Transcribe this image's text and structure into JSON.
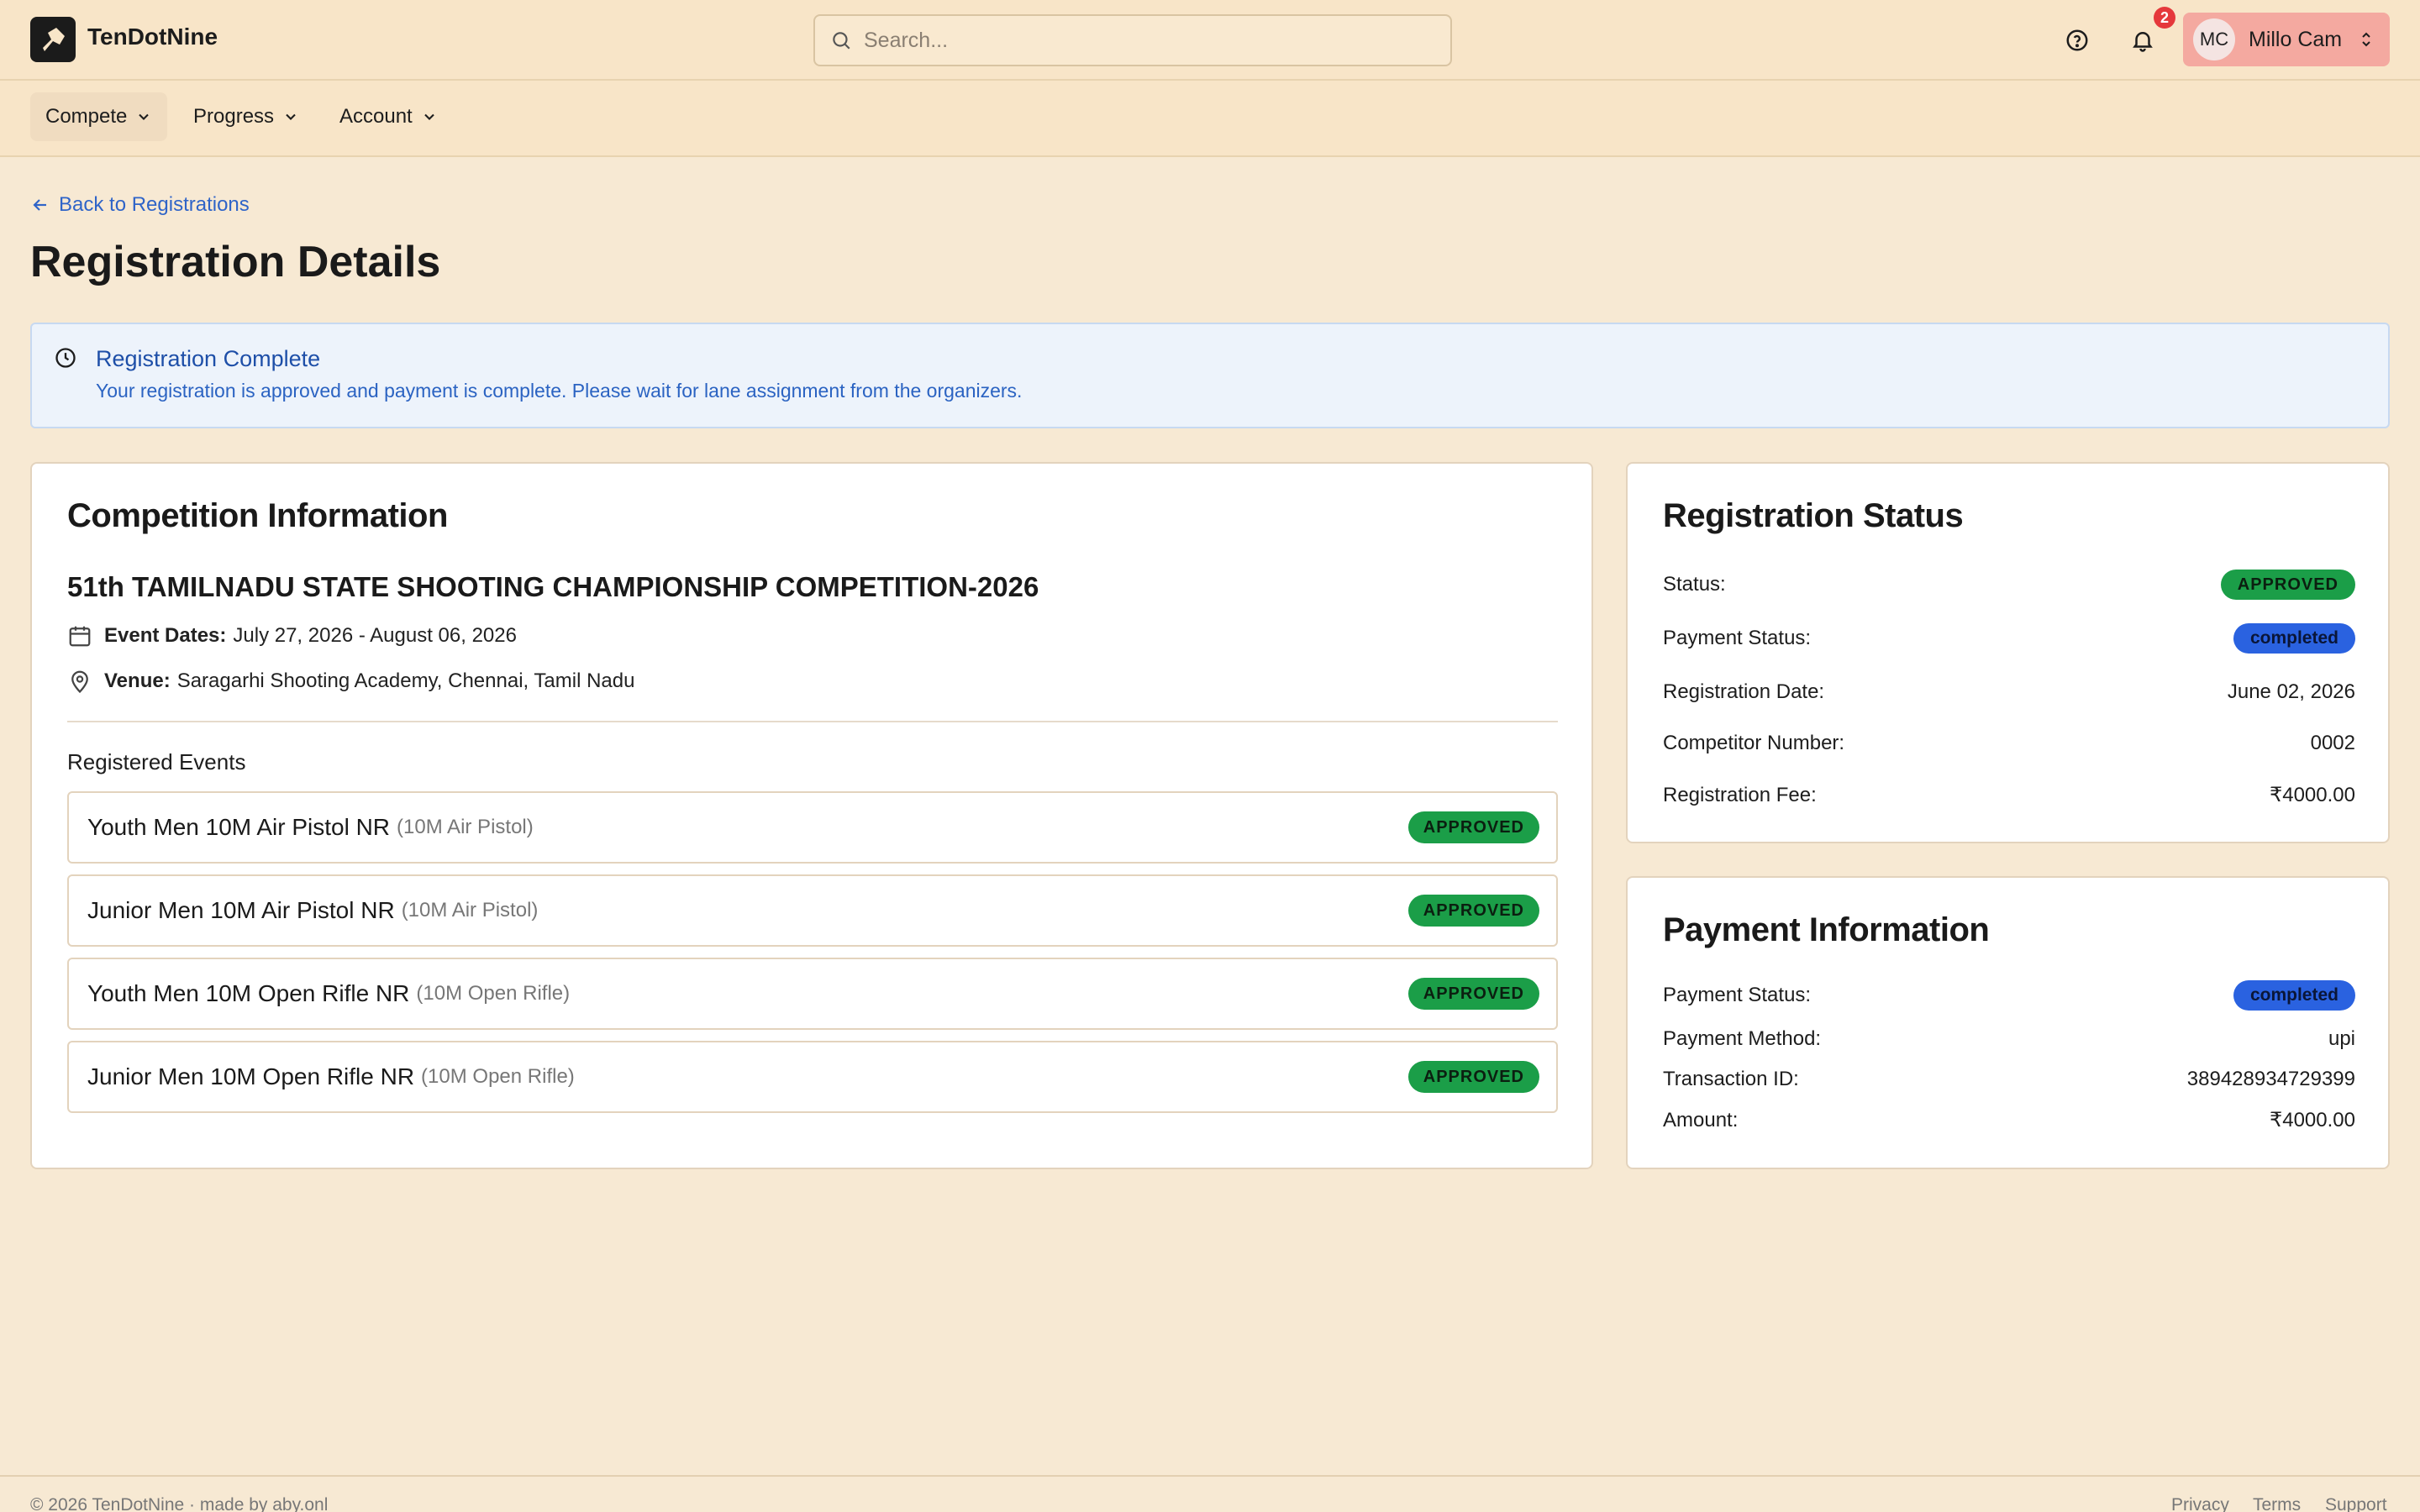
{
  "header": {
    "brand": "TenDotNine",
    "search_placeholder": "Search...",
    "notification_count": "2",
    "user_initials": "MC",
    "user_name": "Millo Cam"
  },
  "nav": {
    "items": [
      {
        "label": "Compete"
      },
      {
        "label": "Progress"
      },
      {
        "label": "Account"
      }
    ]
  },
  "page": {
    "back_link": "Back to Registrations",
    "title": "Registration Details"
  },
  "alert": {
    "title": "Registration Complete",
    "message": "Your registration is approved and payment is complete. Please wait for lane assignment from the organizers."
  },
  "competition": {
    "heading": "Competition Information",
    "name": "51th TAMILNADU STATE SHOOTING CHAMPIONSHIP COMPETITION-2026",
    "dates_label": "Event Dates:",
    "dates_value": "July 27, 2026 - August 06, 2026",
    "venue_label": "Venue:",
    "venue_value": "Saragarhi Shooting Academy, Chennai, Tamil Nadu",
    "registered_label": "Registered Events",
    "events": [
      {
        "name": "Youth Men 10M Air Pistol NR",
        "category": "(10M Air Pistol)",
        "status": "APPROVED"
      },
      {
        "name": "Junior Men 10M Air Pistol NR",
        "category": "(10M Air Pistol)",
        "status": "APPROVED"
      },
      {
        "name": "Youth Men 10M Open Rifle NR",
        "category": "(10M Open Rifle)",
        "status": "APPROVED"
      },
      {
        "name": "Junior Men 10M Open Rifle NR",
        "category": "(10M Open Rifle)",
        "status": "APPROVED"
      }
    ]
  },
  "registration_status": {
    "heading": "Registration Status",
    "status_label": "Status:",
    "status_value": "APPROVED",
    "payment_status_label": "Payment Status:",
    "payment_status_value": "completed",
    "date_label": "Registration Date:",
    "date_value": "June 02, 2026",
    "competitor_label": "Competitor Number:",
    "competitor_value": "0002",
    "fee_label": "Registration Fee:",
    "fee_value": "₹4000.00"
  },
  "payment": {
    "heading": "Payment Information",
    "status_label": "Payment Status:",
    "status_value": "completed",
    "method_label": "Payment Method:",
    "method_value": "upi",
    "txn_label": "Transaction ID:",
    "txn_value": "389428934729399",
    "amount_label": "Amount:",
    "amount_value": "₹4000.00"
  },
  "footer": {
    "copyright": "© 2026 TenDotNine · made by aby.onl",
    "links": [
      "Privacy",
      "Terms",
      "Support"
    ]
  },
  "colors": {
    "background": "#f7e9d3",
    "accent_blue": "#2a62e0",
    "approved_green": "#1b9e48",
    "user_chip": "#f4a9a0"
  }
}
